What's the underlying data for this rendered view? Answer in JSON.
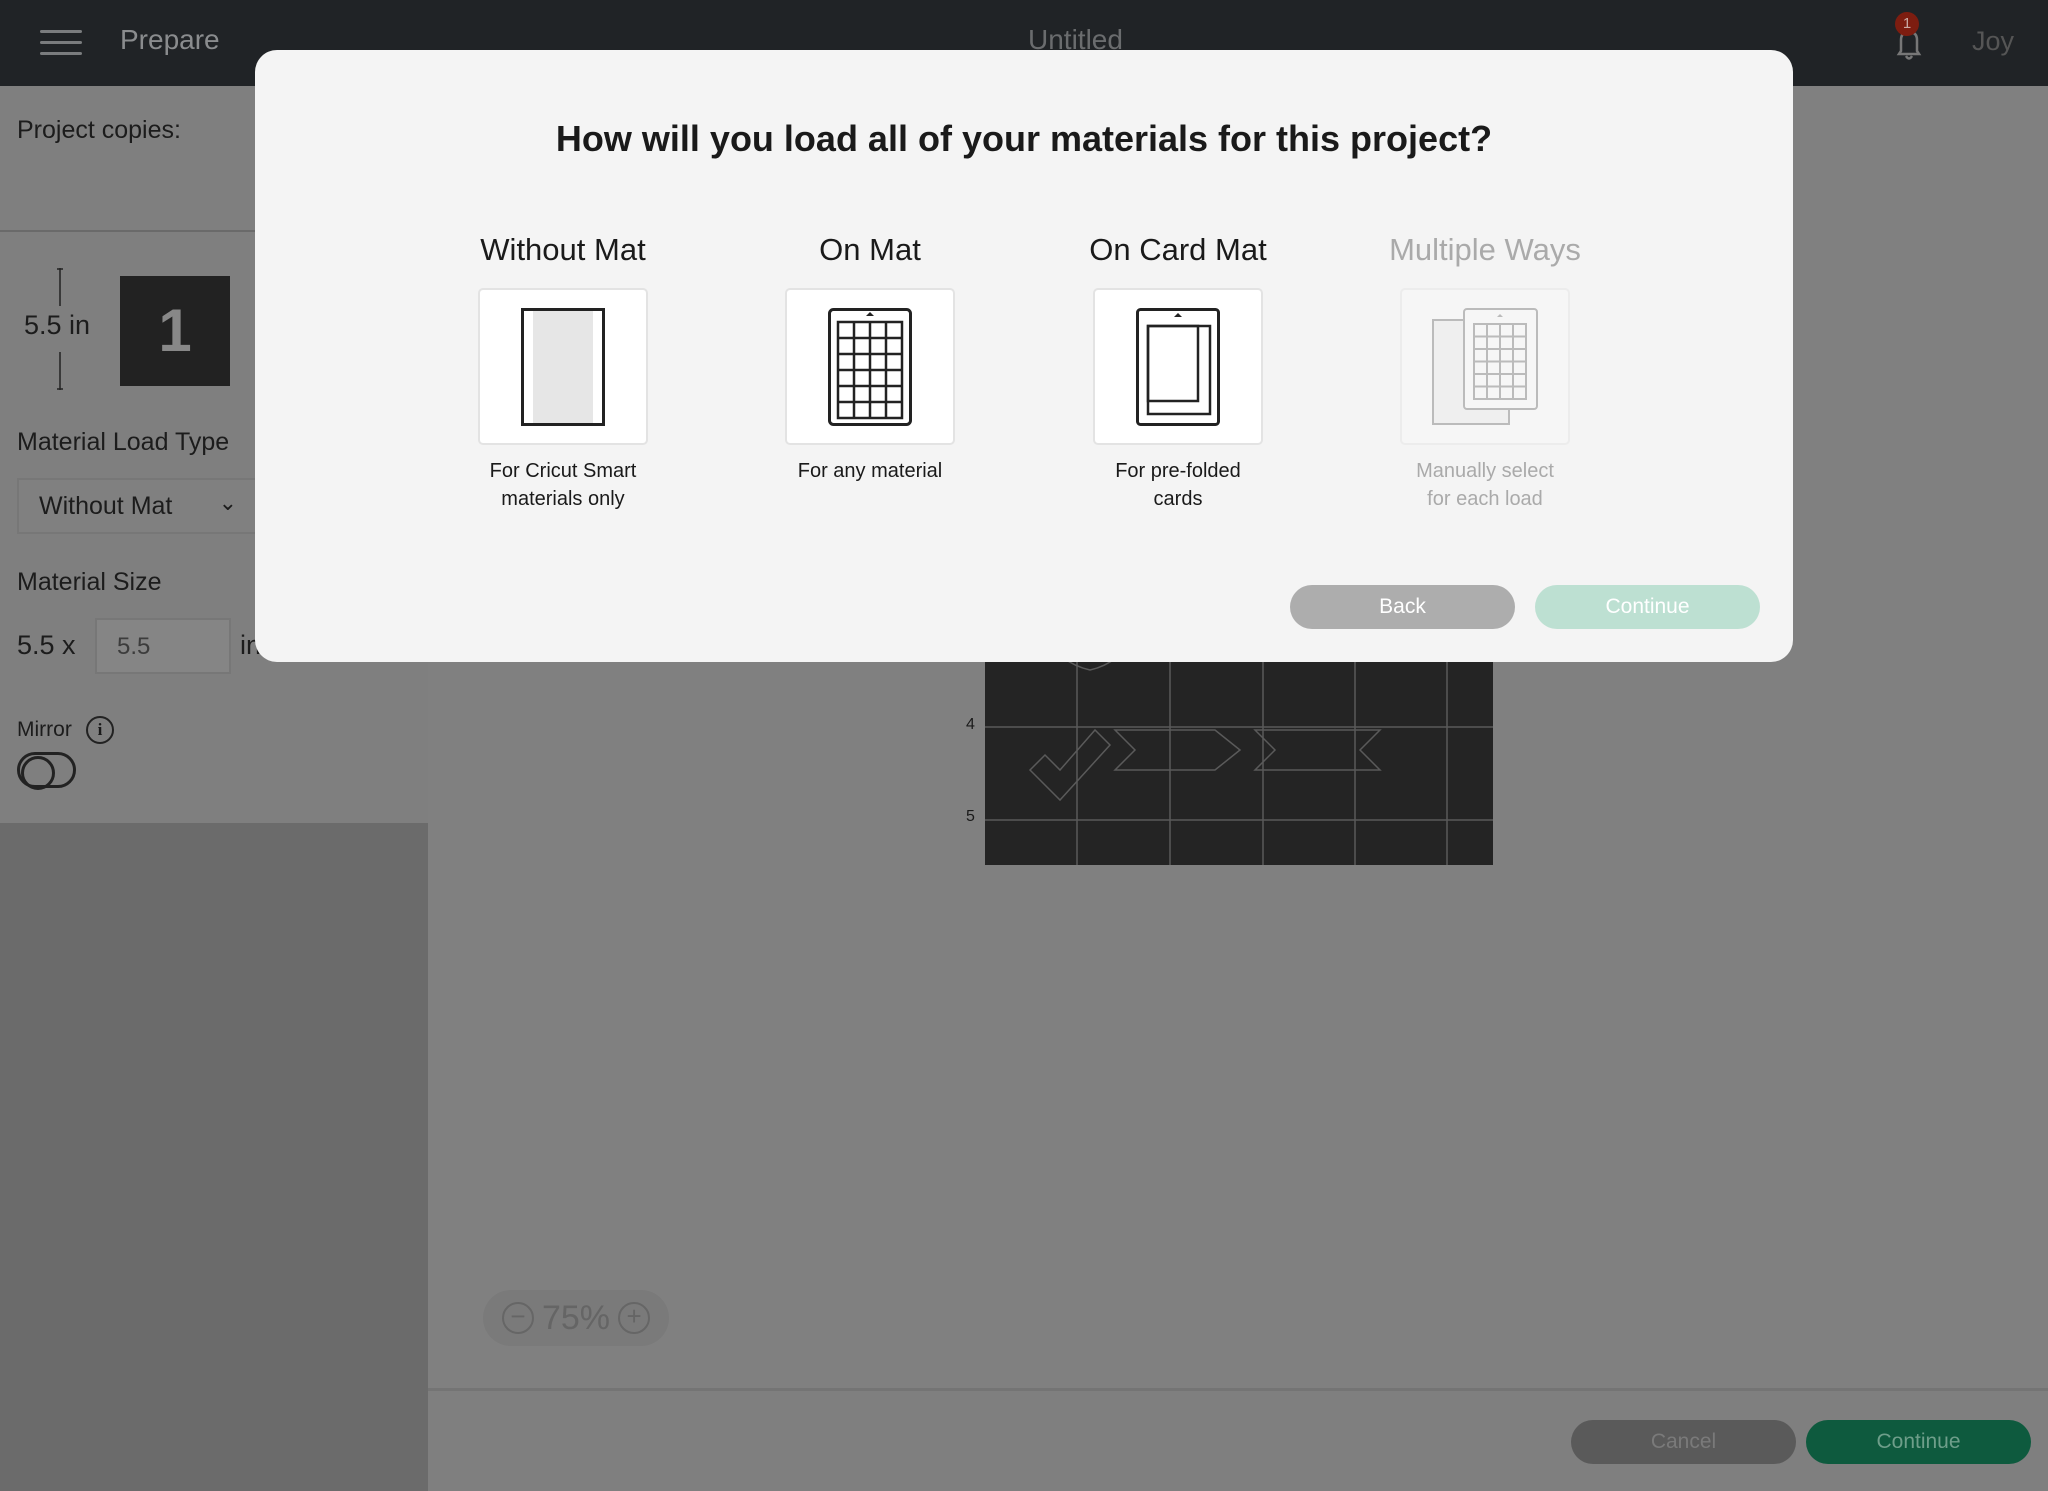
{
  "topbar": {
    "section": "Prepare",
    "document_title": "Untitled",
    "notification_count": "1",
    "user": "Joy"
  },
  "sidebar": {
    "project_copies_label": "Project copies:",
    "mat_height": "5.5 in",
    "mat_number": "1",
    "material_load_type_label": "Material Load Type",
    "material_load_type_value": "Without Mat",
    "material_size_label": "Material Size",
    "material_width": "5.5 x",
    "material_height_value": "5.5",
    "unit": "in",
    "mirror_label": "Mirror",
    "mirror_on": false
  },
  "canvas": {
    "ruler_ticks": [
      "4",
      "5"
    ],
    "zoom": "75%"
  },
  "footer": {
    "cancel": "Cancel",
    "continue": "Continue"
  },
  "modal": {
    "title": "How will you load all of your materials for this project?",
    "options": [
      {
        "title": "Without Mat",
        "caption_1": "For Cricut Smart",
        "caption_2": "materials only",
        "icon": "without-mat-icon",
        "enabled": true
      },
      {
        "title": "On Mat",
        "caption_1": "For any material",
        "caption_2": "",
        "icon": "mat-grid-icon",
        "enabled": true
      },
      {
        "title": "On Card Mat",
        "caption_1": "For pre-folded",
        "caption_2": "cards",
        "icon": "card-mat-icon",
        "enabled": true
      },
      {
        "title": "Multiple Ways",
        "caption_1": "Manually select",
        "caption_2": "for each load",
        "icon": "multiple-ways-icon",
        "enabled": false
      }
    ],
    "back": "Back",
    "continue": "Continue",
    "continue_color": "#bde0d2",
    "accent_color": "#0e5a3e"
  }
}
